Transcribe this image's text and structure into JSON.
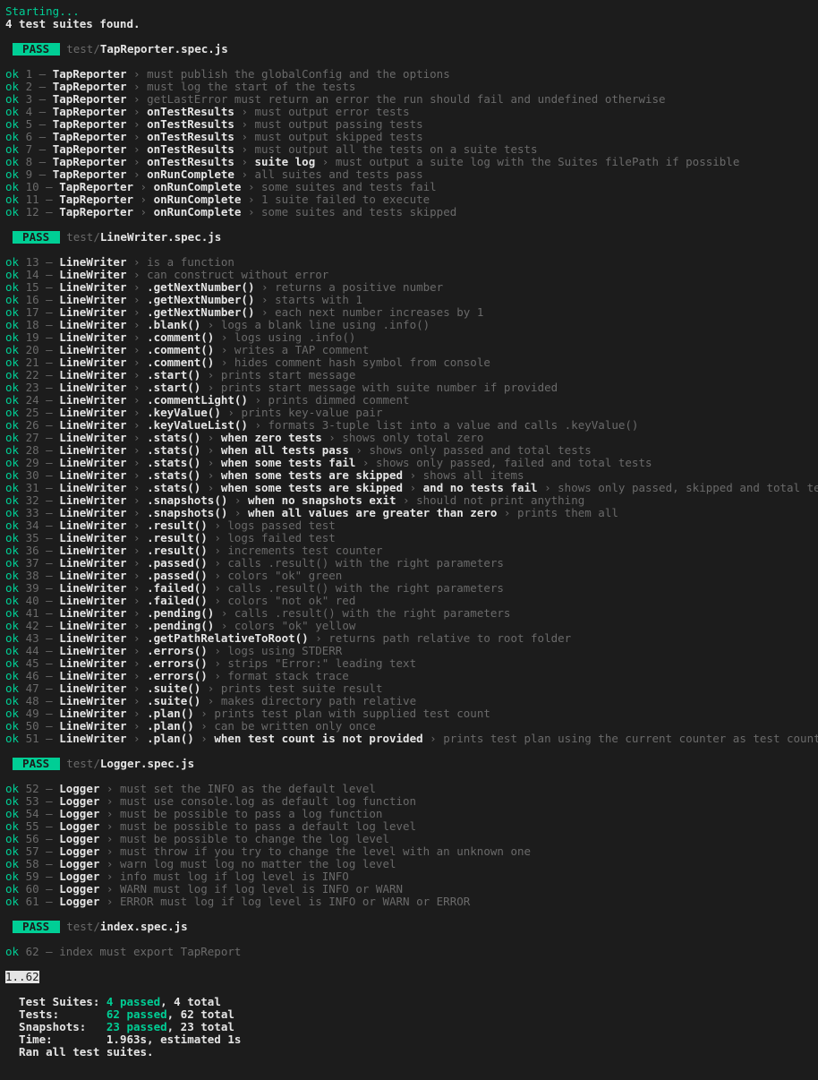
{
  "header": {
    "starting": "Starting...",
    "suites_found": "4 test suites found."
  },
  "pass_label": " PASS ",
  "test_prefix": " test/",
  "suites": [
    {
      "file": "TapReporter.spec.js",
      "tests": [
        {
          "n": 1,
          "path": [
            "TapReporter"
          ],
          "desc": "must publish the globalConfig and the options"
        },
        {
          "n": 2,
          "path": [
            "TapReporter"
          ],
          "desc": "must log the start of the tests"
        },
        {
          "n": 3,
          "path": [
            "TapReporter"
          ],
          "desc": "getLastError must return an error the run should fail and undefined otherwise"
        },
        {
          "n": 4,
          "path": [
            "TapReporter",
            "onTestResults"
          ],
          "desc": "must output error tests"
        },
        {
          "n": 5,
          "path": [
            "TapReporter",
            "onTestResults"
          ],
          "desc": "must output passing tests"
        },
        {
          "n": 6,
          "path": [
            "TapReporter",
            "onTestResults"
          ],
          "desc": "must output skipped tests"
        },
        {
          "n": 7,
          "path": [
            "TapReporter",
            "onTestResults"
          ],
          "desc": "must output all the tests on a suite tests"
        },
        {
          "n": 8,
          "path": [
            "TapReporter",
            "onTestResults",
            "suite log"
          ],
          "desc": "must output a suite log with the Suites filePath if possible"
        },
        {
          "n": 9,
          "path": [
            "TapReporter",
            "onRunComplete"
          ],
          "desc": "all suites and tests pass"
        },
        {
          "n": 10,
          "path": [
            "TapReporter",
            "onRunComplete"
          ],
          "desc": "some suites and tests fail"
        },
        {
          "n": 11,
          "path": [
            "TapReporter",
            "onRunComplete"
          ],
          "desc": "1 suite failed to execute"
        },
        {
          "n": 12,
          "path": [
            "TapReporter",
            "onRunComplete"
          ],
          "desc": "some suites and tests skipped"
        }
      ]
    },
    {
      "file": "LineWriter.spec.js",
      "tests": [
        {
          "n": 13,
          "path": [
            "LineWriter"
          ],
          "desc": "is a function"
        },
        {
          "n": 14,
          "path": [
            "LineWriter"
          ],
          "desc": "can construct without error"
        },
        {
          "n": 15,
          "path": [
            "LineWriter",
            ".getNextNumber()"
          ],
          "desc": "returns a positive number"
        },
        {
          "n": 16,
          "path": [
            "LineWriter",
            ".getNextNumber()"
          ],
          "desc": "starts with 1"
        },
        {
          "n": 17,
          "path": [
            "LineWriter",
            ".getNextNumber()"
          ],
          "desc": "each next number increases by 1"
        },
        {
          "n": 18,
          "path": [
            "LineWriter",
            ".blank()"
          ],
          "desc": "logs a blank line using .info()"
        },
        {
          "n": 19,
          "path": [
            "LineWriter",
            ".comment()"
          ],
          "desc": "logs using .info()"
        },
        {
          "n": 20,
          "path": [
            "LineWriter",
            ".comment()"
          ],
          "desc": "writes a TAP comment"
        },
        {
          "n": 21,
          "path": [
            "LineWriter",
            ".comment()"
          ],
          "desc": "hides comment hash symbol from console"
        },
        {
          "n": 22,
          "path": [
            "LineWriter",
            ".start()"
          ],
          "desc": "prints start message"
        },
        {
          "n": 23,
          "path": [
            "LineWriter",
            ".start()"
          ],
          "desc": "prints start message with suite number if provided"
        },
        {
          "n": 24,
          "path": [
            "LineWriter",
            ".commentLight()"
          ],
          "desc": "prints dimmed comment"
        },
        {
          "n": 25,
          "path": [
            "LineWriter",
            ".keyValue()"
          ],
          "desc": "prints key-value pair"
        },
        {
          "n": 26,
          "path": [
            "LineWriter",
            ".keyValueList()"
          ],
          "desc": "formats 3-tuple list into a value and calls .keyValue()"
        },
        {
          "n": 27,
          "path": [
            "LineWriter",
            ".stats()",
            "when zero tests"
          ],
          "desc": "shows only total zero"
        },
        {
          "n": 28,
          "path": [
            "LineWriter",
            ".stats()",
            "when all tests pass"
          ],
          "desc": "shows only passed and total tests"
        },
        {
          "n": 29,
          "path": [
            "LineWriter",
            ".stats()",
            "when some tests fail"
          ],
          "desc": "shows only passed, failed and total tests"
        },
        {
          "n": 30,
          "path": [
            "LineWriter",
            ".stats()",
            "when some tests are skipped"
          ],
          "desc": "shows all items"
        },
        {
          "n": 31,
          "path": [
            "LineWriter",
            ".stats()",
            "when some tests are skipped",
            "and no tests fail"
          ],
          "desc": "shows only passed, skipped and total tests"
        },
        {
          "n": 32,
          "path": [
            "LineWriter",
            ".snapshots()",
            "when no snapshots exit"
          ],
          "desc": "should not print anything"
        },
        {
          "n": 33,
          "path": [
            "LineWriter",
            ".snapshots()",
            "when all values are greater than zero"
          ],
          "desc": "prints them all"
        },
        {
          "n": 34,
          "path": [
            "LineWriter",
            ".result()"
          ],
          "desc": "logs passed test"
        },
        {
          "n": 35,
          "path": [
            "LineWriter",
            ".result()"
          ],
          "desc": "logs failed test"
        },
        {
          "n": 36,
          "path": [
            "LineWriter",
            ".result()"
          ],
          "desc": "increments test counter"
        },
        {
          "n": 37,
          "path": [
            "LineWriter",
            ".passed()"
          ],
          "desc": "calls .result() with the right parameters"
        },
        {
          "n": 38,
          "path": [
            "LineWriter",
            ".passed()"
          ],
          "desc": "colors \"ok\" green"
        },
        {
          "n": 39,
          "path": [
            "LineWriter",
            ".failed()"
          ],
          "desc": "calls .result() with the right parameters"
        },
        {
          "n": 40,
          "path": [
            "LineWriter",
            ".failed()"
          ],
          "desc": "colors \"not ok\" red"
        },
        {
          "n": 41,
          "path": [
            "LineWriter",
            ".pending()"
          ],
          "desc": "calls .result() with the right parameters"
        },
        {
          "n": 42,
          "path": [
            "LineWriter",
            ".pending()"
          ],
          "desc": "colors \"ok\" yellow"
        },
        {
          "n": 43,
          "path": [
            "LineWriter",
            ".getPathRelativeToRoot()"
          ],
          "desc": "returns path relative to root folder"
        },
        {
          "n": 44,
          "path": [
            "LineWriter",
            ".errors()"
          ],
          "desc": "logs using STDERR"
        },
        {
          "n": 45,
          "path": [
            "LineWriter",
            ".errors()"
          ],
          "desc": "strips \"Error:\" leading text"
        },
        {
          "n": 46,
          "path": [
            "LineWriter",
            ".errors()"
          ],
          "desc": "format stack trace"
        },
        {
          "n": 47,
          "path": [
            "LineWriter",
            ".suite()"
          ],
          "desc": "prints test suite result"
        },
        {
          "n": 48,
          "path": [
            "LineWriter",
            ".suite()"
          ],
          "desc": "makes directory path relative"
        },
        {
          "n": 49,
          "path": [
            "LineWriter",
            ".plan()"
          ],
          "desc": "prints test plan with supplied test count"
        },
        {
          "n": 50,
          "path": [
            "LineWriter",
            ".plan()"
          ],
          "desc": "can be written only once"
        },
        {
          "n": 51,
          "path": [
            "LineWriter",
            ".plan()",
            "when test count is not provided"
          ],
          "desc": "prints test plan using the current counter as test count"
        }
      ]
    },
    {
      "file": "Logger.spec.js",
      "tests": [
        {
          "n": 52,
          "path": [
            "Logger"
          ],
          "desc": "must set the INFO as the default level"
        },
        {
          "n": 53,
          "path": [
            "Logger"
          ],
          "desc": "must use console.log as default log function"
        },
        {
          "n": 54,
          "path": [
            "Logger"
          ],
          "desc": "must be possible to pass a log function"
        },
        {
          "n": 55,
          "path": [
            "Logger"
          ],
          "desc": "must be possible to pass a default log level"
        },
        {
          "n": 56,
          "path": [
            "Logger"
          ],
          "desc": "must be possible to change the log level"
        },
        {
          "n": 57,
          "path": [
            "Logger"
          ],
          "desc": "must throw if you try to change the level with an unknown one"
        },
        {
          "n": 58,
          "path": [
            "Logger"
          ],
          "desc": "warn log must log no matter the log level"
        },
        {
          "n": 59,
          "path": [
            "Logger"
          ],
          "desc": "info must log if log level is INFO"
        },
        {
          "n": 60,
          "path": [
            "Logger"
          ],
          "desc": "WARN must log if log level is INFO or WARN"
        },
        {
          "n": 61,
          "path": [
            "Logger"
          ],
          "desc": "ERROR must log if log level is INFO or WARN or ERROR"
        }
      ]
    },
    {
      "file": "index.spec.js",
      "tests": [
        {
          "n": 62,
          "path": [],
          "desc": "index must export TapReport"
        }
      ]
    }
  ],
  "plan": "1..62",
  "summary": {
    "indent": "  ",
    "rows": [
      {
        "label": "Test Suites: ",
        "pass": "4 passed",
        "rest": ", 4 total"
      },
      {
        "label": "Tests:       ",
        "pass": "62 passed",
        "rest": ", 62 total"
      },
      {
        "label": "Snapshots:   ",
        "pass": "23 passed",
        "rest": ", 23 total"
      },
      {
        "label": "Time:        ",
        "pass": "",
        "rest": "1.963s, estimated 1s"
      }
    ],
    "ran": "Ran all test suites."
  },
  "tokens": {
    "ok": "ok",
    "dash": " – ",
    "arrow": " › "
  }
}
